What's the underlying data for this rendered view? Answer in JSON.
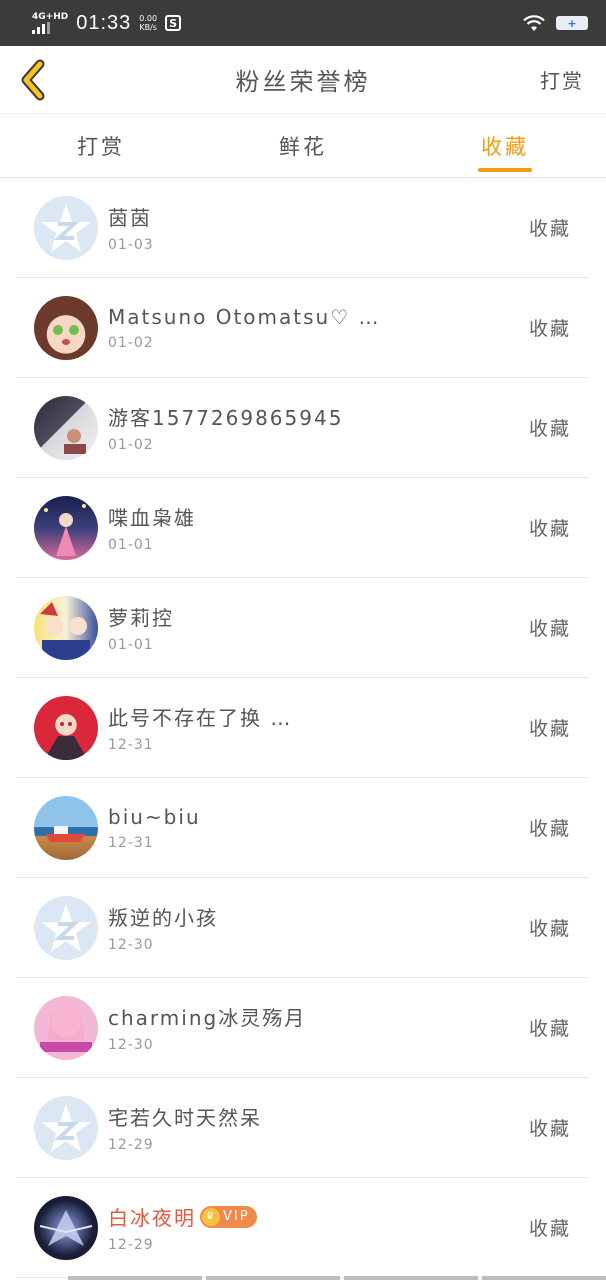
{
  "status": {
    "network": "4G+HD",
    "time": "01:33",
    "speed_value": "0.00",
    "speed_unit": "KB/s",
    "app_icon": "S",
    "battery_label": "+"
  },
  "header": {
    "title": "粉丝荣誉榜",
    "action": "打赏"
  },
  "tabs": [
    {
      "label": "打赏",
      "active": false
    },
    {
      "label": "鲜花",
      "active": false
    },
    {
      "label": "收藏",
      "active": true
    }
  ],
  "rows": [
    {
      "name": "茵茵",
      "date": "01-03",
      "action": "收藏",
      "avatar": "default-avatar"
    },
    {
      "name": "Matsuno Otomatsu♡ …",
      "date": "01-02",
      "action": "收藏",
      "avatar": "anime-girl-green-eyes"
    },
    {
      "name": "游客1577269865945",
      "date": "01-02",
      "action": "收藏",
      "avatar": "photo-room"
    },
    {
      "name": "喋血枭雄",
      "date": "01-01",
      "action": "收藏",
      "avatar": "anime-night-sky"
    },
    {
      "name": "萝莉控",
      "date": "01-01",
      "action": "收藏",
      "avatar": "anime-group"
    },
    {
      "name": "此号不存在了换 …",
      "date": "12-31",
      "action": "收藏",
      "avatar": "anime-red-hair"
    },
    {
      "name": "biu~biu",
      "date": "12-31",
      "action": "收藏",
      "avatar": "boat-on-beach"
    },
    {
      "name": "叛逆的小孩",
      "date": "12-30",
      "action": "收藏",
      "avatar": "default-avatar"
    },
    {
      "name": "charming冰灵殇月",
      "date": "12-30",
      "action": "收藏",
      "avatar": "anime-pink-girl"
    },
    {
      "name": "宅若久时天然呆",
      "date": "12-29",
      "action": "收藏",
      "avatar": "default-avatar"
    },
    {
      "name": "白冰夜明",
      "date": "12-29",
      "action": "收藏",
      "avatar": "dark-dragon",
      "vip": "VIP"
    }
  ],
  "colors": {
    "accent": "#f39c12",
    "vip_name": "#e8583c",
    "status_bar": "#3b3b3b"
  }
}
